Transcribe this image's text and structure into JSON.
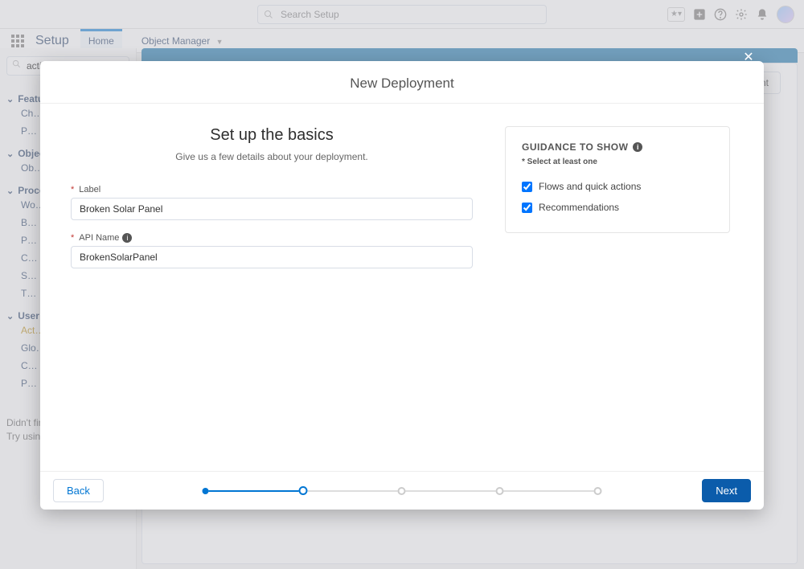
{
  "header": {
    "search_placeholder": "Search Setup"
  },
  "appnav": {
    "title": "Setup",
    "tab_home": "Home",
    "tab_object_manager": "Object Manager"
  },
  "sidebar": {
    "search_value": "actio",
    "sections": [
      {
        "label": "Feature",
        "items": [
          "Ch…",
          "P…"
        ]
      },
      {
        "label": "Objects",
        "items": [
          "Ob…"
        ]
      },
      {
        "label": "Process",
        "items": [
          "Wo…",
          "B…",
          "P…",
          "C…",
          "S…",
          "T…"
        ]
      },
      {
        "label": "User In",
        "items": [
          "Act…",
          "Glo…",
          "C…",
          "P…"
        ]
      }
    ],
    "footer_line1": "Didn't fin…",
    "footer_line2": "Try using …"
  },
  "mainbg": {
    "button_label": "…ment"
  },
  "modal": {
    "title": "New Deployment",
    "page_title": "Set up the basics",
    "page_subtitle": "Give us a few details about your deployment.",
    "label_field_label": "Label",
    "label_value": "Broken Solar Panel",
    "api_field_label": "API Name",
    "api_value": "BrokenSolarPanel",
    "guidance": {
      "title": "GUIDANCE TO SHOW",
      "subtitle": "Select at least one",
      "opt1": "Flows and quick actions",
      "opt2": "Recommendations"
    },
    "back_label": "Back",
    "next_label": "Next"
  }
}
